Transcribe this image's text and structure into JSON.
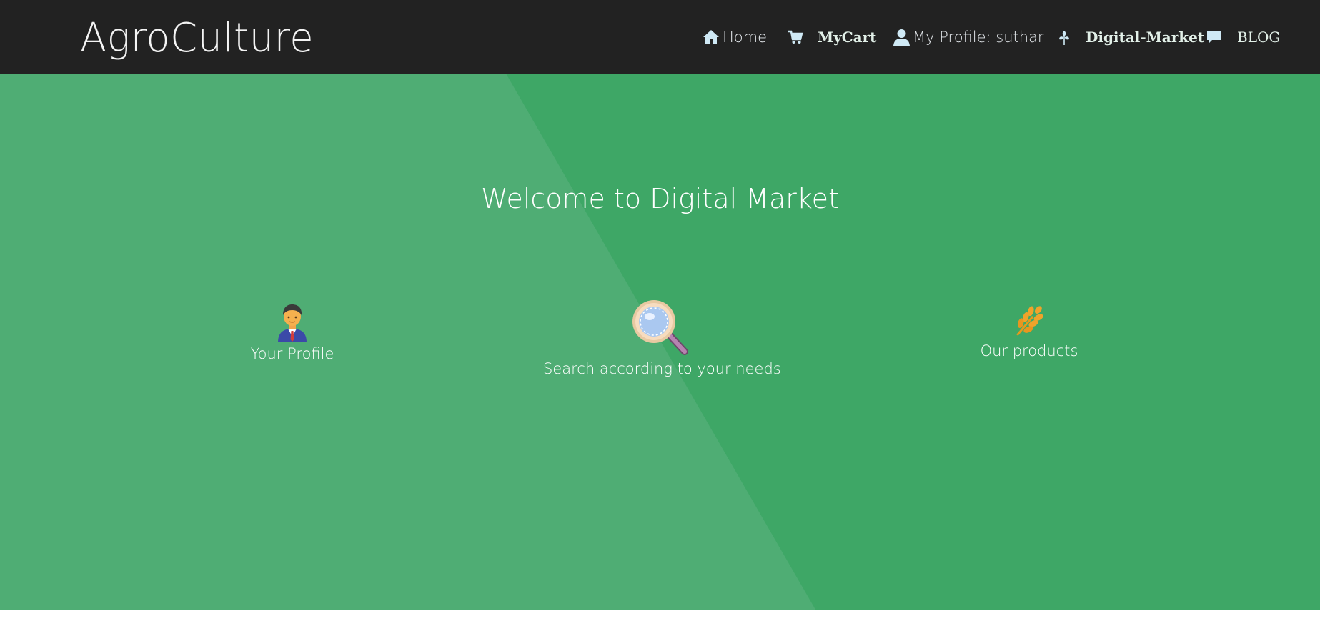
{
  "header": {
    "brand": "AgroCulture",
    "nav": [
      {
        "label": "Home",
        "icon": "home-icon"
      },
      {
        "label": "MyCart",
        "icon": "cart-icon"
      },
      {
        "label": "My Profile: suthar",
        "icon": "user-icon"
      },
      {
        "label": "Digital-Market",
        "icon": "leaf-icon"
      },
      {
        "label": "BLOG",
        "icon": "comment-icon"
      }
    ]
  },
  "hero": {
    "title": "Welcome to Digital Market",
    "features": [
      {
        "label": "Your Profile",
        "icon": "businessman-icon"
      },
      {
        "label": "Search according to your needs",
        "icon": "magnifier-icon"
      },
      {
        "label": "Our products",
        "icon": "wheat-icon"
      }
    ]
  },
  "colors": {
    "topbar": "#222222",
    "hero_dark": "#3ea766",
    "hero_light": "#4fad74",
    "text": "#ffffff"
  }
}
